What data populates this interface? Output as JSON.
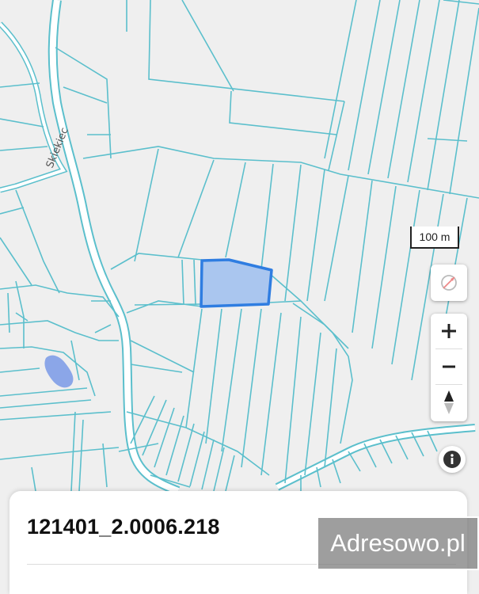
{
  "map": {
    "street_label": "Skiekiec",
    "scale_label": "100 m",
    "parcel_line_color": "#5bbfcc",
    "selected_fill": "#aac6ef",
    "selected_stroke": "#2f7de1",
    "water_color": "#8ba6e8"
  },
  "controls": {
    "zoom_in_icon": "plus-icon",
    "zoom_out_icon": "minus-icon",
    "compass_icon": "compass-icon",
    "north_icon": "north-arrow-icon",
    "info_icon": "info-icon"
  },
  "parcel": {
    "id": "121401_2.0006.218"
  },
  "watermark": {
    "text": "Adresowo.pl"
  }
}
